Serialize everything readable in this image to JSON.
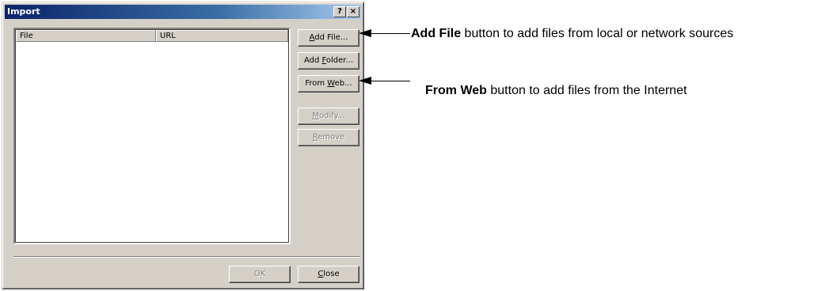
{
  "window": {
    "title": "Import",
    "help_button": "?",
    "close_button": "×"
  },
  "list": {
    "columns": [
      "File",
      "URL"
    ],
    "rows": []
  },
  "buttons": {
    "add_file": {
      "prefix": "",
      "underline": "A",
      "suffix": "dd File..."
    },
    "add_folder": {
      "prefix": "Add ",
      "underline": "F",
      "suffix": "older..."
    },
    "from_web": {
      "prefix": "From ",
      "underline": "W",
      "suffix": "eb..."
    },
    "modify": {
      "prefix": "",
      "underline": "M",
      "suffix": "odify..."
    },
    "remove": {
      "prefix": "",
      "underline": "R",
      "suffix": "emove"
    },
    "ok": {
      "label": "OK"
    },
    "close": {
      "prefix": "",
      "underline": "C",
      "suffix": "lose"
    }
  },
  "callouts": {
    "add_file": {
      "bold": "Add File",
      "text": " button to add files from local or network sources"
    },
    "from_web": {
      "bold": "From Web",
      "text": " button to add files from the Internet"
    }
  }
}
